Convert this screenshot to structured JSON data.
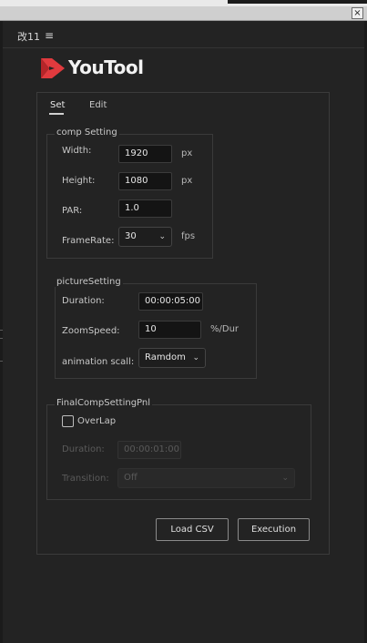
{
  "panel": {
    "title": "改11"
  },
  "brand": {
    "name": "YouTool",
    "logo_color": "#e03a3e"
  },
  "window": {
    "close_glyph": "×"
  },
  "tabs": [
    {
      "label": "Set",
      "active": true
    },
    {
      "label": "Edit",
      "active": false
    }
  ],
  "comp_setting": {
    "legend": "comp Setting",
    "width_label": "Width:",
    "width_value": "1920",
    "width_unit": "px",
    "height_label": "Height:",
    "height_value": "1080",
    "height_unit": "px",
    "par_label": "PAR:",
    "par_value": "1.0",
    "framerate_label": "FrameRate:",
    "framerate_value": "30",
    "framerate_unit": "fps"
  },
  "picture_setting": {
    "legend": "pictureSetting",
    "duration_label": "Duration:",
    "duration_value": "00:00:05:00",
    "zoomspeed_label": "ZoomSpeed:",
    "zoomspeed_value": "10",
    "zoomspeed_unit": "%/Dur",
    "animation_label": "animation scall:",
    "animation_value": "Ramdom"
  },
  "final_comp": {
    "legend": "FinalCompSettingPnl",
    "overlap_label": "OverLap",
    "overlap_checked": false,
    "duration_label": "Duration:",
    "duration_value": "00:00:01:00",
    "transition_label": "Transition:",
    "transition_value": "Off"
  },
  "buttons": {
    "load_csv": "Load CSV",
    "execution": "Execution"
  }
}
